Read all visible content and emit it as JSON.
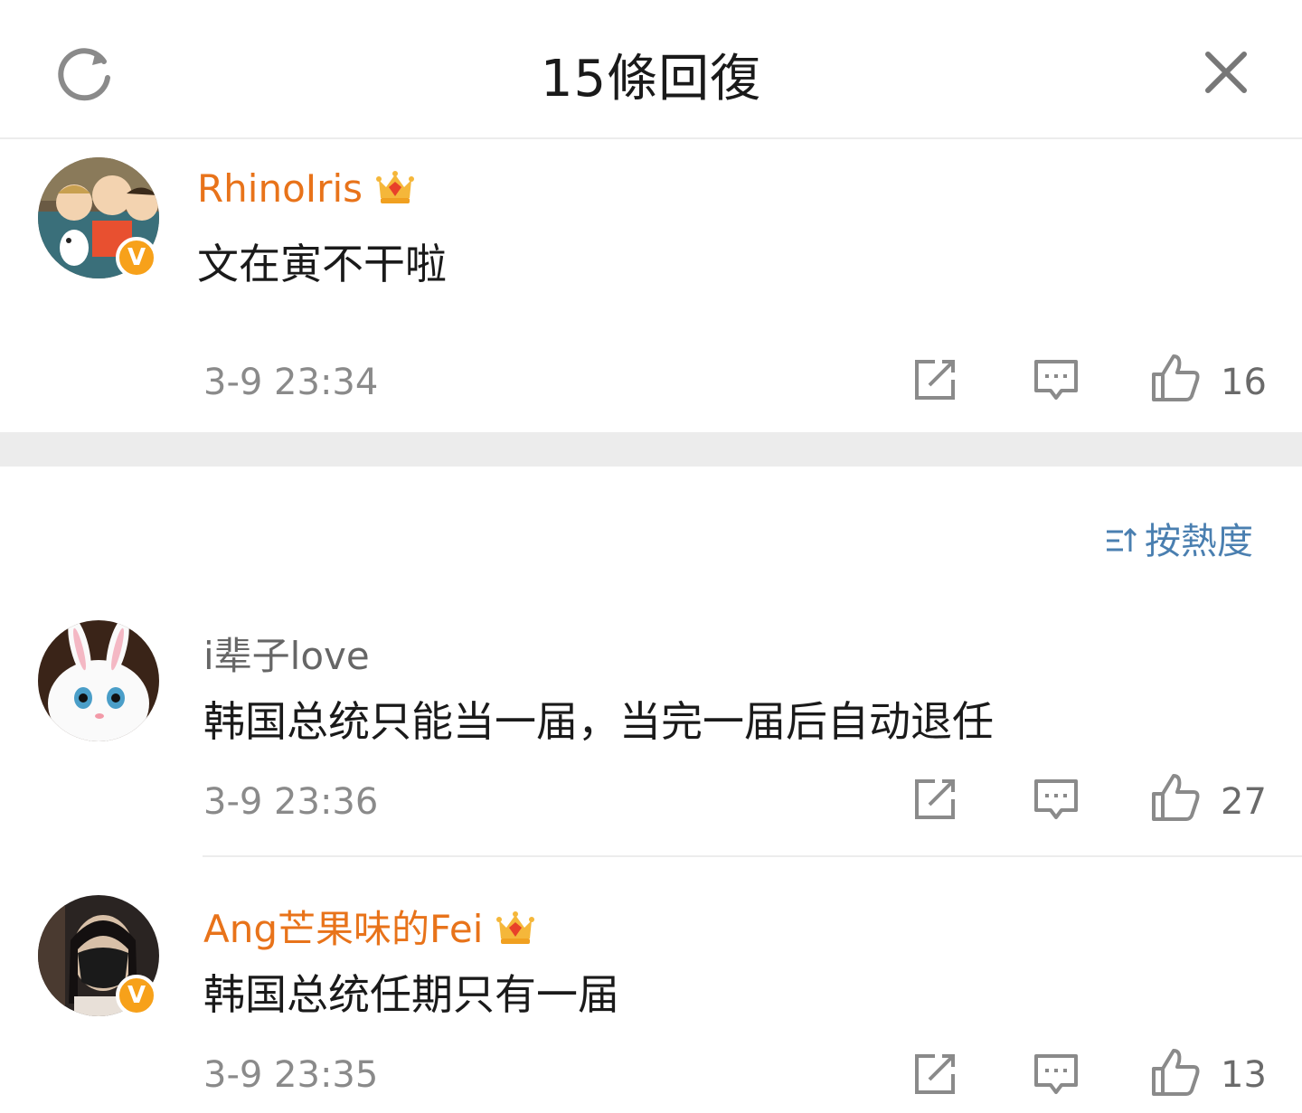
{
  "header": {
    "title": "15條回復",
    "refresh_icon": "refresh-icon",
    "close_icon": "close-icon"
  },
  "main_comment": {
    "username": "RhinoIris",
    "badge": "crown-badge-icon",
    "verified": "V",
    "text": "文在寅不干啦",
    "time": "3-9 23:34",
    "likes": "16"
  },
  "sort": {
    "label": "按熱度",
    "icon": "sort-icon"
  },
  "replies": [
    {
      "username": "i辈子love",
      "text": "韩国总统只能当一届，当完一届后自动退任",
      "time": "3-9 23:36",
      "likes": "27"
    },
    {
      "username": "Ang芒果味的Fei",
      "badge": "crown-badge-icon",
      "verified": "V",
      "text": "韩国总统任期只有一届",
      "time": "3-9 23:35",
      "likes": "13"
    }
  ],
  "colors": {
    "vip_name": "#e8731a",
    "sort_link": "#4a7fb0",
    "verified_badge": "#f7a11a"
  }
}
